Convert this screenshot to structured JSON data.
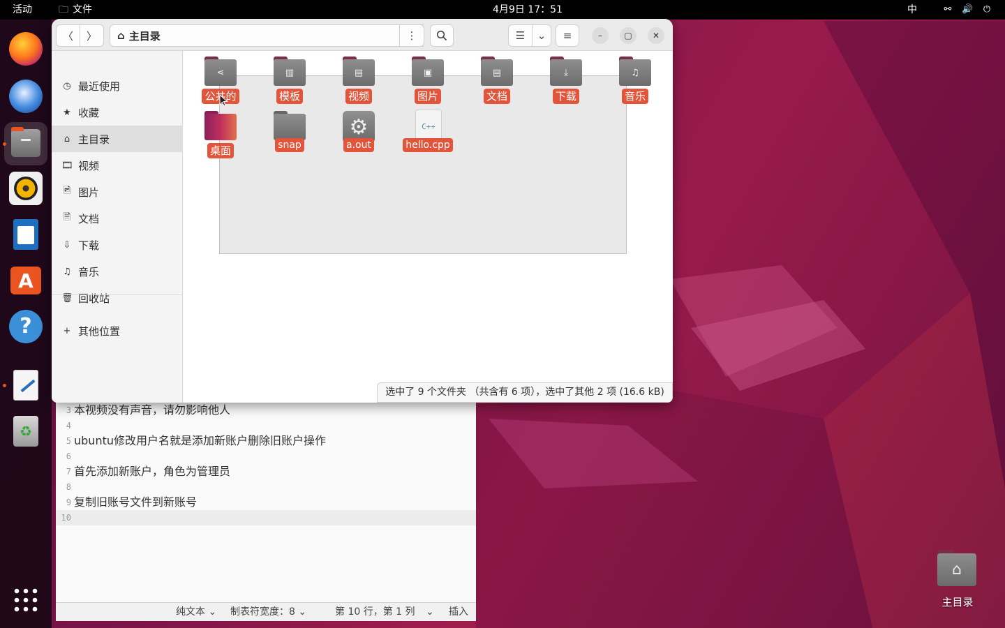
{
  "topbar": {
    "activities": "活动",
    "app_name": "文件",
    "clock": "4月9日 17：51",
    "input_method": "中"
  },
  "file_manager": {
    "path": "主目录",
    "sidebar": [
      {
        "label": "最近使用",
        "icon": "clock-icon"
      },
      {
        "label": "收藏",
        "icon": "star-icon"
      },
      {
        "label": "主目录",
        "icon": "home-icon",
        "selected": true
      },
      {
        "label": "视频",
        "icon": "film-icon"
      },
      {
        "label": "图片",
        "icon": "image-icon"
      },
      {
        "label": "文档",
        "icon": "document-icon"
      },
      {
        "label": "下载",
        "icon": "download-icon"
      },
      {
        "label": "音乐",
        "icon": "music-icon"
      },
      {
        "label": "回收站",
        "icon": "trash-icon"
      }
    ],
    "other_locations": "其他位置",
    "files": [
      {
        "name": "公共的",
        "type": "folder",
        "glyph": "share-icon"
      },
      {
        "name": "模板",
        "type": "folder",
        "glyph": "template-icon"
      },
      {
        "name": "视频",
        "type": "folder",
        "glyph": "film-icon"
      },
      {
        "name": "图片",
        "type": "folder",
        "glyph": "image-icon"
      },
      {
        "name": "文档",
        "type": "folder",
        "glyph": "document-icon"
      },
      {
        "name": "下载",
        "type": "folder",
        "glyph": "download-icon"
      },
      {
        "name": "音乐",
        "type": "folder",
        "glyph": "music-icon"
      },
      {
        "name": "桌面",
        "type": "folder",
        "glyph": "desktop-icon"
      },
      {
        "name": "snap",
        "type": "folder",
        "glyph": ""
      },
      {
        "name": "a.out",
        "type": "executable",
        "glyph": "gear-icon"
      },
      {
        "name": "hello.cpp",
        "type": "source",
        "glyph": "C++"
      }
    ],
    "status": "选中了 9 个文件夹 （共含有 6 项），选中了其他 2 项 (16.6 kB)"
  },
  "editor": {
    "lines": [
      {
        "n": "3",
        "text": "本视频没有声音，请勿影响他人"
      },
      {
        "n": "4",
        "text": ""
      },
      {
        "n": "5",
        "text": "ubuntu修改用户名就是添加新账户删除旧账户操作"
      },
      {
        "n": "6",
        "text": ""
      },
      {
        "n": "7",
        "text": "首先添加新账户，角色为管理员"
      },
      {
        "n": "8",
        "text": ""
      },
      {
        "n": "9",
        "text": "复制旧账号文件到新账号"
      },
      {
        "n": "10",
        "text": ""
      }
    ],
    "status": {
      "syntax": "纯文本",
      "tab_width": "制表符宽度：8",
      "position": "第 10 行，第 1 列",
      "mode": "插入"
    }
  },
  "desktop": {
    "home_label": "主目录"
  }
}
